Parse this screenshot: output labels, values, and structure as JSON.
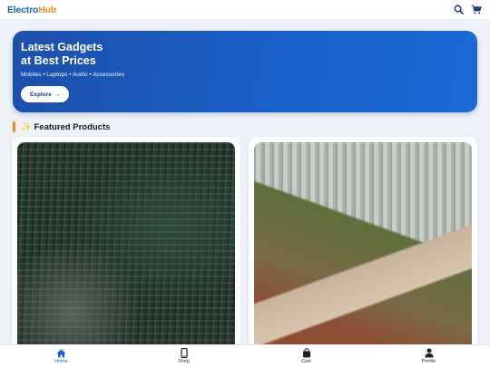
{
  "app": {
    "logo_part1": "Electro",
    "logo_part2": "Hub"
  },
  "header": {
    "icons": [
      "search-icon",
      "cart-icon"
    ]
  },
  "hero": {
    "title_line1": "Latest Gadgets",
    "title_line2": "at Best Prices",
    "subtitle": "Mobiles • Laptops • Audio • Accessories",
    "button_label": "Explore",
    "button_arrow": "→"
  },
  "featured": {
    "emoji": "✨",
    "title": "Featured Products"
  },
  "products": [
    {
      "image": "forest-photo"
    },
    {
      "image": "forest-road-photo"
    }
  ],
  "nav": {
    "items": [
      {
        "label": "Home",
        "icon": "home-icon",
        "active": true
      },
      {
        "label": "Shop",
        "icon": "phone-icon",
        "active": false
      },
      {
        "label": "Cart",
        "icon": "bag-icon",
        "active": false
      },
      {
        "label": "Profile",
        "icon": "person-icon",
        "active": false
      }
    ]
  },
  "colors": {
    "brand": "#1565c0",
    "accent": "#f28c1b",
    "hero_start": "#1d4faa",
    "hero_end": "#1a6ad6"
  }
}
